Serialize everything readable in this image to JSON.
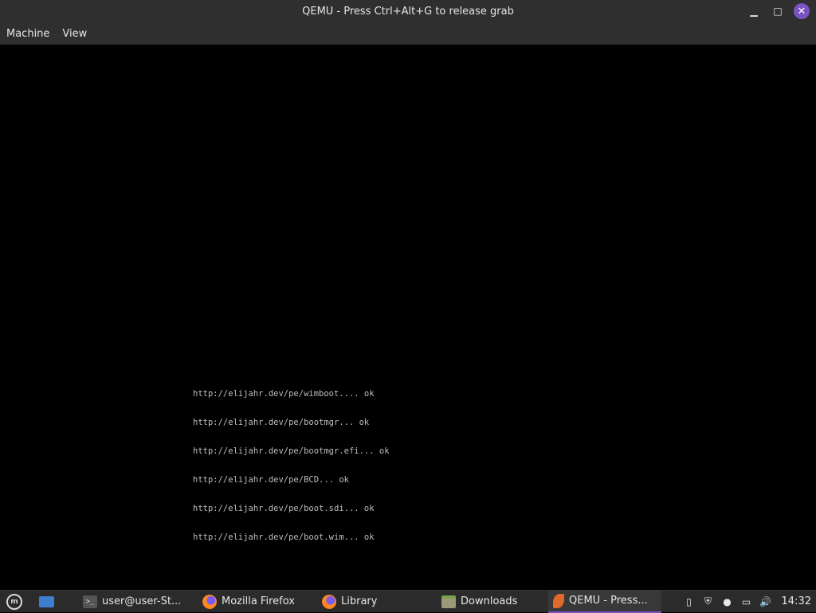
{
  "window": {
    "title": "QEMU - Press Ctrl+Alt+G to release grab",
    "minimize_glyph": "▁",
    "maximize_glyph": "□",
    "close_glyph": "✕"
  },
  "menubar": {
    "items": [
      {
        "label": "Machine"
      },
      {
        "label": "View"
      }
    ]
  },
  "boot_log": {
    "lines": [
      "http://elijahr.dev/pe/wimboot.... ok",
      "http://elijahr.dev/pe/bootmgr... ok",
      "http://elijahr.dev/pe/bootmgr.efi... ok",
      "http://elijahr.dev/pe/BCD... ok",
      "http://elijahr.dev/pe/boot.sdi... ok",
      "http://elijahr.dev/pe/boot.wim... ok"
    ]
  },
  "taskbar": {
    "menu_icon": "linux-mint-icon",
    "show_desktop_icon": "show-desktop-icon",
    "tasks": [
      {
        "label": "user@user-St...",
        "icon": "terminal-icon"
      },
      {
        "label": "Mozilla Firefox",
        "icon": "firefox-icon"
      },
      {
        "label": "Library",
        "icon": "firefox-icon"
      },
      {
        "label": "Downloads",
        "icon": "folder-icon"
      },
      {
        "label": "QEMU - Press...",
        "icon": "qemu-icon",
        "active": true
      }
    ],
    "tray": [
      {
        "icon": "clipboard-icon",
        "glyph": "▯"
      },
      {
        "icon": "shield-icon",
        "glyph": "⛨"
      },
      {
        "icon": "user-icon",
        "glyph": "●"
      },
      {
        "icon": "network-icon",
        "glyph": "▭"
      },
      {
        "icon": "volume-icon",
        "glyph": "🔊"
      }
    ],
    "clock": "14:32"
  },
  "colors": {
    "accent": "#7b52c2",
    "titlebar_bg": "#2f2f2f",
    "taskbar_bg": "#2b2b2b",
    "console_text": "#bdbdbd"
  }
}
